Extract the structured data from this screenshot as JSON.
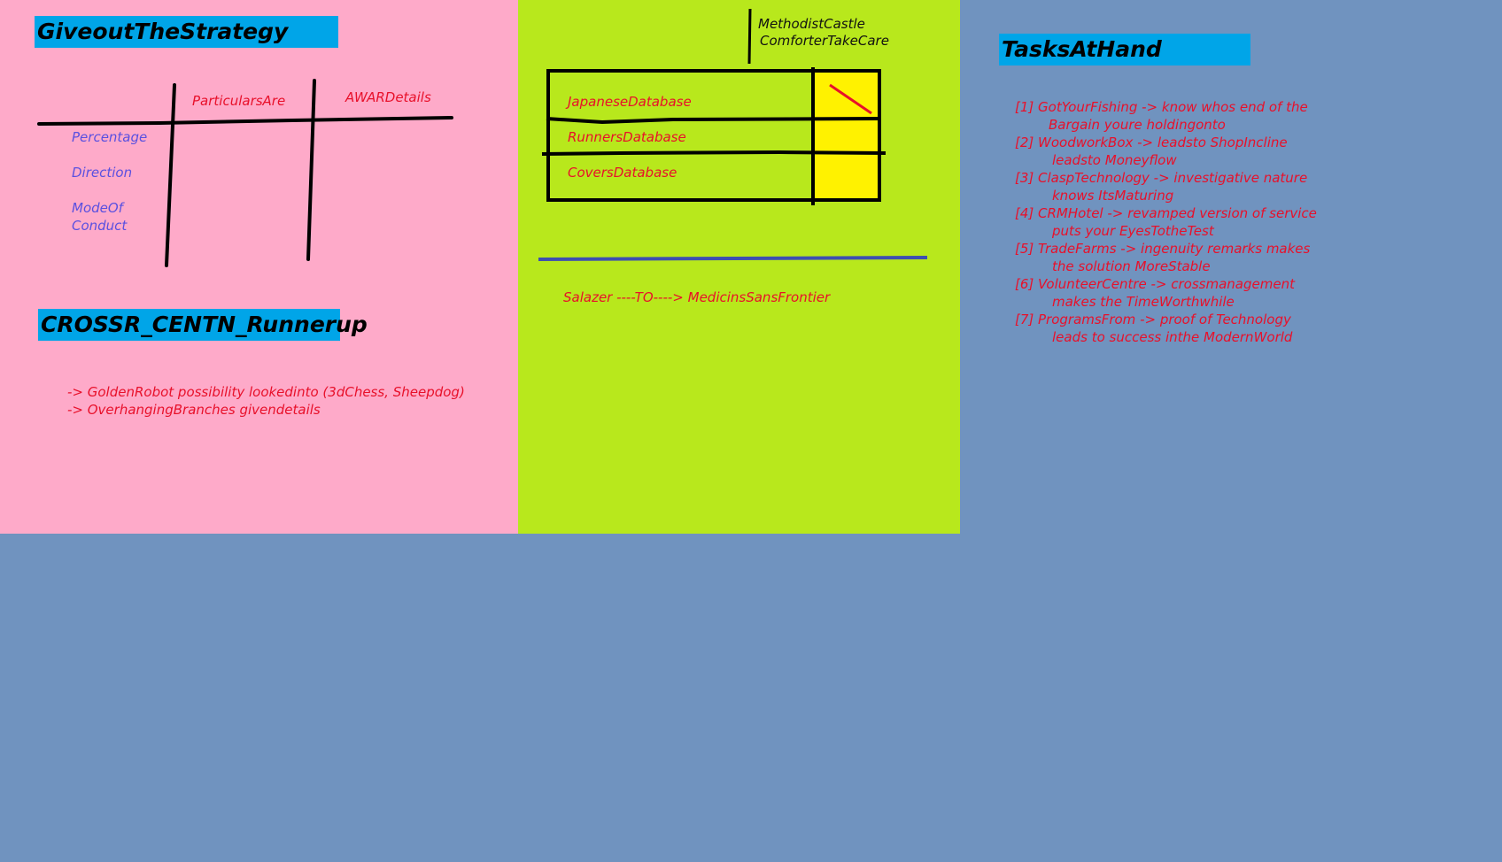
{
  "strategy": {
    "title": "GiveoutTheStrategy",
    "col1": "ParticularsAre",
    "col2": "AWARDetails",
    "rows": [
      "Percentage",
      "Direction",
      "ModeOf",
      "Conduct"
    ]
  },
  "runnerup": {
    "title": "CROSSR_CENTN_Runnerup",
    "items": [
      "-> GoldenRobot possibility lookedinto  (3dChess, Sheepdog)",
      "-> OverhangingBranches givendetails"
    ]
  },
  "databases": {
    "note_line1": "MethodistCastle",
    "note_line2": "ComforterTakeCare",
    "rows": [
      "JapaneseDatabase",
      "RunnersDatabase",
      "CoversDatabase"
    ],
    "flow": "Salazer ----TO----> MedicinsSansFrontier"
  },
  "tasks": {
    "title": "TasksAtHand",
    "items": [
      {
        "line1": "[1] GotYourFishing -> know whos end of the",
        "line2": "Bargain youre holdingonto"
      },
      {
        "line1": "[2] WoodworkBox -> leadsto ShopIncline",
        "line2": "leadsto Moneyflow"
      },
      {
        "line1": "[3] ClaspTechnology -> investigative nature",
        "line2": "knows ItsMaturing"
      },
      {
        "line1": "[4] CRMHotel -> revamped version of service",
        "line2": "puts your EyesTotheTest"
      },
      {
        "line1": "[5] TradeFarms -> ingenuity remarks makes",
        "line2": "the solution MoreStable"
      },
      {
        "line1": "[6] VolunteerCentre -> crossmanagement",
        "line2": "makes the TimeWorthwhile"
      },
      {
        "line1": "[7] ProgramsFrom -> proof of Technology",
        "line2": "leads to success inthe ModernWorld"
      }
    ]
  },
  "colors": {
    "background": "#7093bf",
    "pink_panel": "#feaac9",
    "green_panel": "#b8e81c",
    "title_bar": "#00a5e8",
    "red_text": "#e8102a",
    "blue_text": "#5a50e0",
    "yellow_box": "#fff200"
  }
}
